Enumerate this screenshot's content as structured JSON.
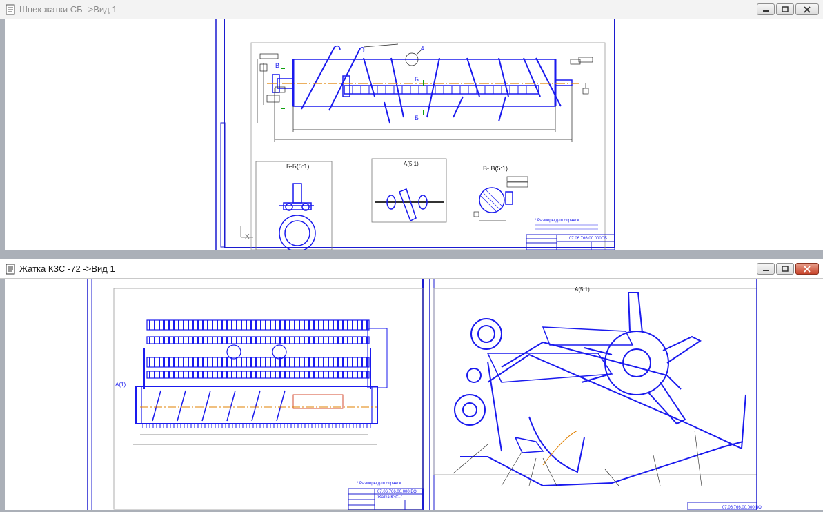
{
  "windows": [
    {
      "title": "Шнек жатки СБ ->Вид 1",
      "controls": [
        "minimize-icon",
        "maximize-icon",
        "close-icon"
      ]
    },
    {
      "title": "Жатка КЗС -72 ->Вид 1",
      "controls": [
        "minimize-icon",
        "maximize-icon",
        "close-icon"
      ]
    }
  ],
  "drawing_top": {
    "section_bb": "Б-Б(5:1)",
    "section_a": "А(5:1)",
    "section_vv": "В- В(5:1)",
    "callout_4": "4",
    "label_b1": "Б",
    "label_b2": "Б",
    "label_v": "В",
    "axis_x": "X",
    "notes_title": "* Размеры для справок",
    "stamp_code": "07.06.766.00.000СБ"
  },
  "drawing_bottom": {
    "view_a": "А(5:1)",
    "label_a": "А(1)",
    "notes_title": "* Размеры для справок",
    "stamp_code": "07.06.766.00.000 ВО",
    "stamp_name": "Жатка КЗС-7",
    "stamp_code_right": "07.06.766.00.000 ВО"
  },
  "colors": {
    "line": "#1a1aee",
    "axis": "#e08000",
    "dim": "#222222",
    "frame": "#1c1cd0"
  }
}
